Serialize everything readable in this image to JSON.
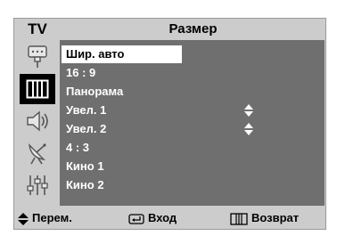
{
  "header": {
    "mode_label": "TV",
    "title": "Размер"
  },
  "sidebar": {
    "items": [
      {
        "icon": "antenna-input-icon",
        "active": false
      },
      {
        "icon": "picture-icon",
        "active": true
      },
      {
        "icon": "sound-icon",
        "active": false
      },
      {
        "icon": "satellite-dish-icon",
        "active": false
      },
      {
        "icon": "equalizer-sliders-icon",
        "active": false
      }
    ]
  },
  "menu": {
    "items": [
      {
        "label": "Шир. авто",
        "selected": true
      },
      {
        "label": "16 : 9"
      },
      {
        "label": "Панорама"
      },
      {
        "label": "Увел. 1",
        "arrows": true
      },
      {
        "label": "Увел. 2",
        "arrows": true
      },
      {
        "label": "4 : 3"
      },
      {
        "label": "Кино 1"
      },
      {
        "label": "Кино 2"
      }
    ]
  },
  "footer": {
    "move_label": "Перем.",
    "enter_label": "Вход",
    "return_label": "Возврат"
  },
  "colors": {
    "frame": "#cccccc",
    "panel": "#6f6f6f",
    "selected_bg": "#ffffff",
    "text_light": "#ffffff"
  }
}
